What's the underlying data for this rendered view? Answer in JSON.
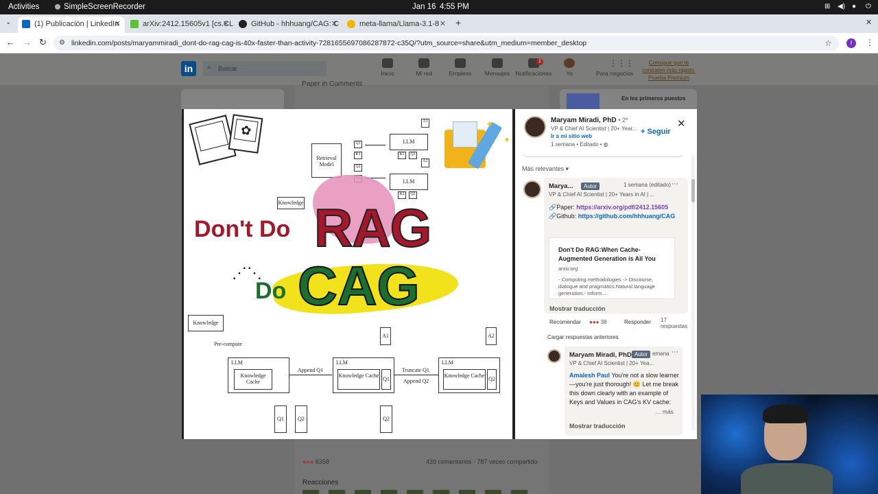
{
  "system": {
    "activities": "Activities",
    "app": "SimpleScreenRecorder",
    "date": "Jan 16",
    "time": "4:55 PM"
  },
  "tabs": [
    {
      "label": "(1) Publicación | LinkedIn",
      "color": "#0a66c2"
    },
    {
      "label": "arXiv:2412.15605v1 [cs.CL",
      "color": "#5bc236"
    },
    {
      "label": "GitHub - hhhuang/CAG: C",
      "color": "#222"
    },
    {
      "label": "meta-llama/Llama-3.1-8",
      "color": "#f5b400"
    }
  ],
  "address": {
    "url": "linkedin.com/posts/maryammiradi_dont-do-rag-cag-is-40x-faster-than-activity-7281655697086287872-c35Q/?utm_source=share&utm_medium=member_desktop",
    "profile_initial": "I"
  },
  "linkedin": {
    "logo": "in",
    "search_placeholder": "Buscar",
    "nav": [
      "Inicio",
      "Mi red",
      "Empleos",
      "Mensajes",
      "Notificaciones",
      "Yo",
      "Para negocios"
    ],
    "notif_count": "1",
    "premium": "Consigue que te contraten más rápido: Prueba Premium",
    "feed_paper": "Paper in Comments",
    "right_card": "En los primeros puestos",
    "reactions_count": "6358",
    "stats": "439 comentarios · 787 veces compartido",
    "reacciones": "Reacciones"
  },
  "image": {
    "headline1": "Don't Do",
    "headline_rag": "RAG",
    "headline_do": "Do",
    "headline_cag": "CAG",
    "top_diagram": {
      "retrieval": "Retrieval Model",
      "knowledge": "Knowledge",
      "llm": "LLM",
      "q1": "Q1",
      "k1": "K1",
      "q2": "Q2",
      "k2": "K2",
      "a1": "A1",
      "a2": "A2"
    },
    "bottom_diagram": {
      "knowledge": "Knowledge",
      "precompute": "Pre-compute",
      "llm": "LLM",
      "kcache": "Knowledge Cache",
      "append_q1": "Append Q1",
      "truncate": "Truncate Q1",
      "append_q2": "Append Q2",
      "q1": "Q1",
      "q2": "Q2",
      "a1": "A1",
      "a2": "A2"
    }
  },
  "post": {
    "author": "Maryam Miradi, PhD",
    "degree": "• 2º",
    "headline": "VP & Chief AI Scientist | 20+ Year...",
    "website": "Ir a mi sitio web",
    "time": "1 semana • Editado •",
    "follow": "+ Seguir",
    "sort": "Más relevantes"
  },
  "comment1": {
    "author": "Marya...",
    "badge": "Autor",
    "time": "1 semana (editado)",
    "headline": "VP & Chief AI Scientist | 20+ Years in AI | ...",
    "paper_label": "🔗Paper: ",
    "paper_link": "https://arxiv.org/pdf/2412.15605",
    "github_label": "🔗Github: ",
    "github_link": "https://github.com/hhhuang/CAG",
    "card_title": "Don't Do RAG:When Cache-Augmented Generation is All You",
    "card_source": "arxiv.org",
    "card_desc": "- Computing methodologies -> Discourse, dialogue and pragmatics.Natural language generation.- Inform...",
    "translate": "Mostrar traducción",
    "recommend": "Recomendar",
    "react_count": "38",
    "reply": "Responder",
    "replies": "17 respuestas",
    "load_prev": "Cargar respuestas anteriores"
  },
  "comment2": {
    "author": "Maryam Miradi, PhD",
    "badge": "Autor",
    "time": "emana",
    "headline": "VP & Chief AI Scientist | 20+ Yea...",
    "mention": "Amalesh Paul",
    "text": " You're not a slow learner—you're just thorough! 😊 Let me break this down clearly with an example of Keys and Values in CAG's KV cache:",
    "more": "… más",
    "translate": "Mostrar traducción"
  },
  "colors": {
    "rag": "#a3182a",
    "cag": "#1c6e2e",
    "pink": "#e58fb8",
    "yellow": "#f2e21b",
    "dontdo": "#a3182a"
  }
}
